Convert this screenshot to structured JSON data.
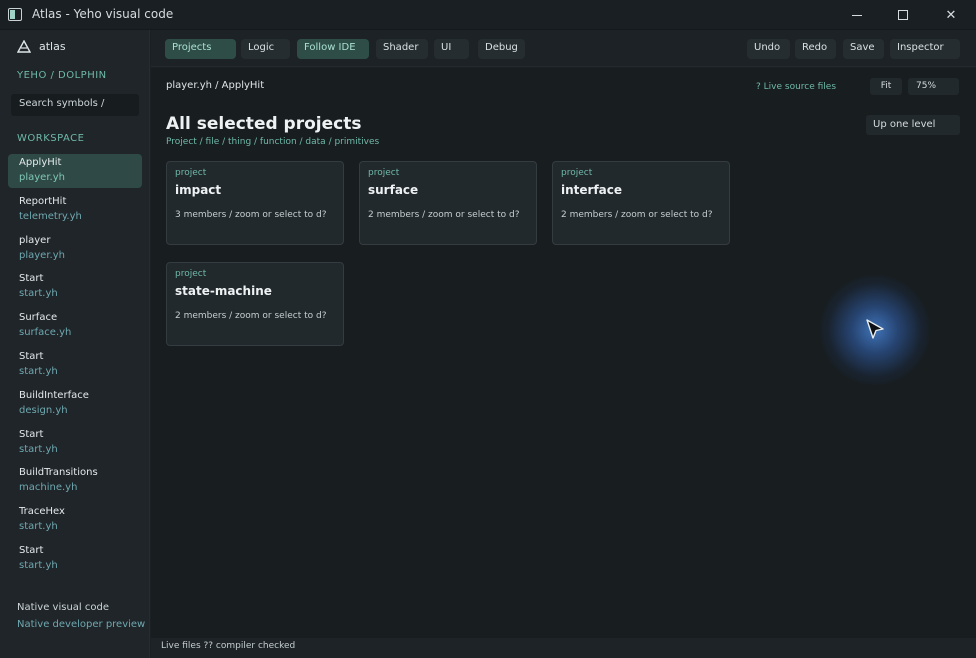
{
  "window": {
    "title": "Atlas - Yeho visual code",
    "minimize_glyph": "",
    "close_glyph": "✕"
  },
  "sidebar": {
    "logo_text": "atlas",
    "project_crumb": "YEHO / DOLPHIN",
    "search_placeholder": "Search symbols  /",
    "workspace_label": "WORKSPACE",
    "items": [
      {
        "name": "ApplyHit",
        "file": "player.yh",
        "active": true
      },
      {
        "name": "ReportHit",
        "file": "telemetry.yh"
      },
      {
        "name": "player",
        "file": "player.yh"
      },
      {
        "name": "Start",
        "file": "start.yh"
      },
      {
        "name": "Surface",
        "file": "surface.yh"
      },
      {
        "name": "Start",
        "file": "start.yh"
      },
      {
        "name": "BuildInterface",
        "file": "design.yh"
      },
      {
        "name": "Start",
        "file": "start.yh"
      },
      {
        "name": "BuildTransitions",
        "file": "machine.yh"
      },
      {
        "name": "TraceHex",
        "file": "start.yh"
      },
      {
        "name": "Start",
        "file": "start.yh"
      }
    ],
    "footer_title": "Native visual code",
    "footer_sub": "Native developer preview"
  },
  "toolbar": {
    "projects": "Projects",
    "logic": "Logic",
    "follow_ide": "Follow IDE",
    "shader": "Shader",
    "ui": "UI",
    "debug": "Debug",
    "undo": "Undo",
    "redo": "Redo",
    "save": "Save",
    "inspector": "Inspector"
  },
  "main": {
    "path": "player.yh   /   ApplyHit",
    "live_source": "?  Live source files",
    "fit": "Fit",
    "zoom": "75%",
    "up_one_level": "Up one level",
    "heading": "All selected projects",
    "kinds": "Project / file / thing / function / data / primitives",
    "cards": [
      {
        "kind": "project",
        "name": "impact",
        "meta": "3 members / zoom or select to d?"
      },
      {
        "kind": "project",
        "name": "surface",
        "meta": "2 members / zoom or select to d?"
      },
      {
        "kind": "project",
        "name": "interface",
        "meta": "2 members / zoom or select to d?"
      },
      {
        "kind": "project",
        "name": "state-machine",
        "meta": "2 members / zoom or select to d?"
      }
    ]
  },
  "status": {
    "text": "Live files ?? compiler checked"
  },
  "colors": {
    "accent": "#6fb9a9",
    "active_bg": "#2f4a46",
    "background": "#181d20"
  }
}
